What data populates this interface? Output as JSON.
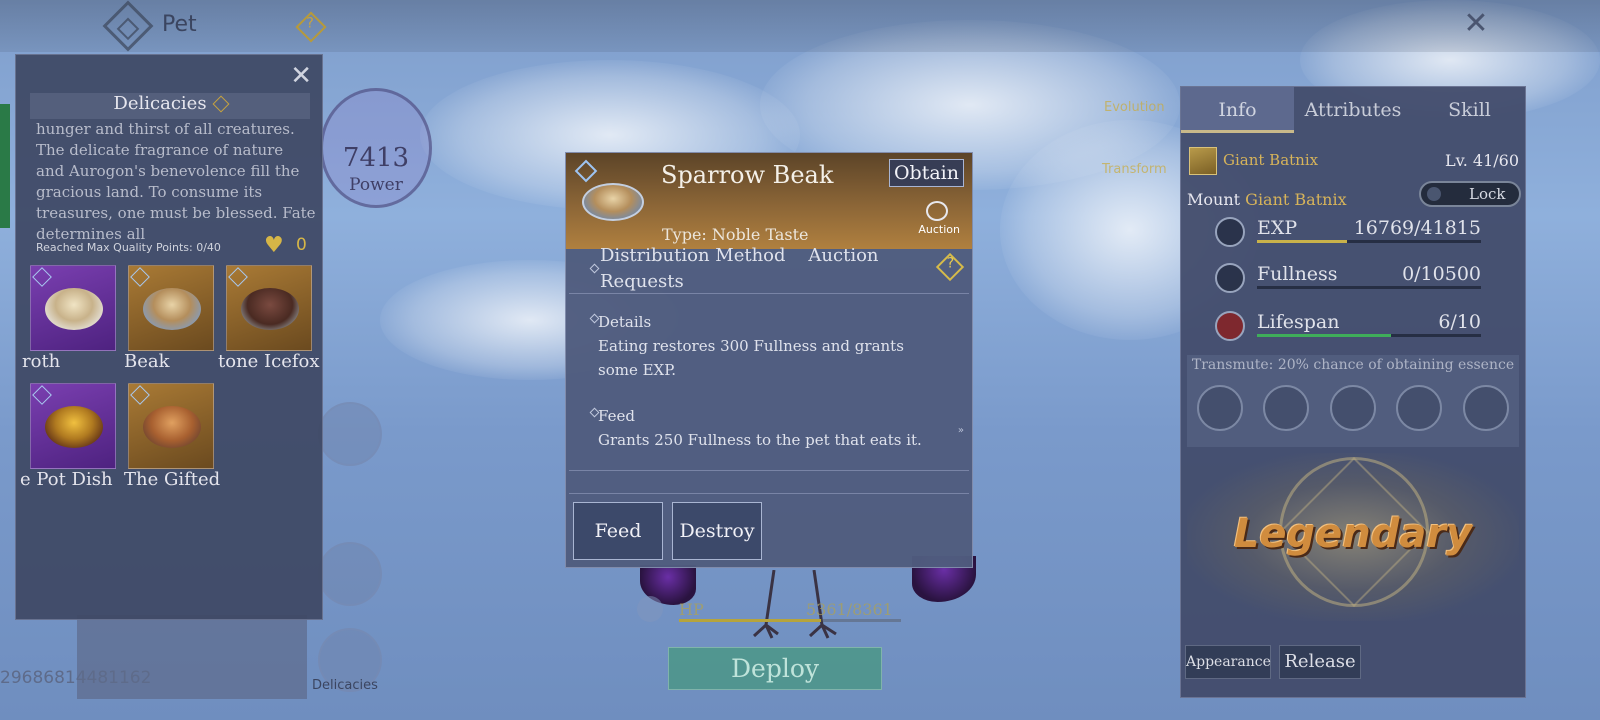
{
  "topbar": {
    "title": "Pet",
    "help_glyph": "?",
    "close_glyph": "✕"
  },
  "left_panel": {
    "close_glyph": "✕",
    "title": "Delicacies",
    "description": "hunger and thirst of all creatures. The delicate fragrance of nature and Aurogon's benevolence fill the gracious land. To consume its treasures, one must be blessed. Fate determines all",
    "max_quality": "Reached Max Quality Points: 0/40",
    "hearts": "0",
    "items": [
      {
        "label": "roth",
        "color": "purple"
      },
      {
        "label": "Beak",
        "color": "orange"
      },
      {
        "label": "tone Icefox",
        "color": "orange"
      },
      {
        "label": "e Pot Dish",
        "color": "purple"
      },
      {
        "label": "The Gifted",
        "color": "orange"
      }
    ]
  },
  "power": {
    "value": "7413",
    "label": "Power"
  },
  "side_buttons": {
    "delicacies_label": "Delicacies"
  },
  "id_text": "29686814481162",
  "faint": {
    "top": "Evolution",
    "bottom": "Transform"
  },
  "modal": {
    "title": "Sparrow Beak",
    "obtain_label": "Obtain",
    "auction_label": "Auction",
    "type": "Type: Noble Taste",
    "distribution_line1": "Distribution Method    Auction",
    "distribution_line2": "Requests",
    "help_glyph": "?",
    "details_label": "Details",
    "details_line1": "Eating restores 300 Fullness and grants",
    "details_line2": "some EXP.",
    "feed_label": "Feed",
    "feed_text": "Grants 250 Fullness to the pet that eats it.",
    "scroll_glyph": "»",
    "feed_button": "Feed",
    "destroy_button": "Destroy"
  },
  "hp": {
    "label": "HP",
    "value": "5361/8361",
    "fraction": 0.64
  },
  "deploy_label": "Deploy",
  "right_panel": {
    "tabs": [
      "Info",
      "Attributes",
      "Skill"
    ],
    "active_tab": "Info",
    "pet_name": "Giant Batnix",
    "level": "Lv. 41/60",
    "mount_prefix": "Mount",
    "mount_name": "Giant Batnix",
    "lock_label": "Lock",
    "stats": [
      {
        "label": "EXP",
        "value": "16769/41815",
        "fraction": 0.4,
        "color": "#c9b24a"
      },
      {
        "label": "Fullness",
        "value": "0/10500",
        "fraction": 0.0,
        "color": "#8a95b0"
      },
      {
        "label": "Lifespan",
        "value": "6/10",
        "fraction": 0.6,
        "color": "#3fae5a"
      }
    ],
    "transmute": "Transmute: 20% chance of obtaining essence",
    "rarity": "Legendary",
    "appearance_button": "Appearance",
    "release_button": "Release"
  }
}
